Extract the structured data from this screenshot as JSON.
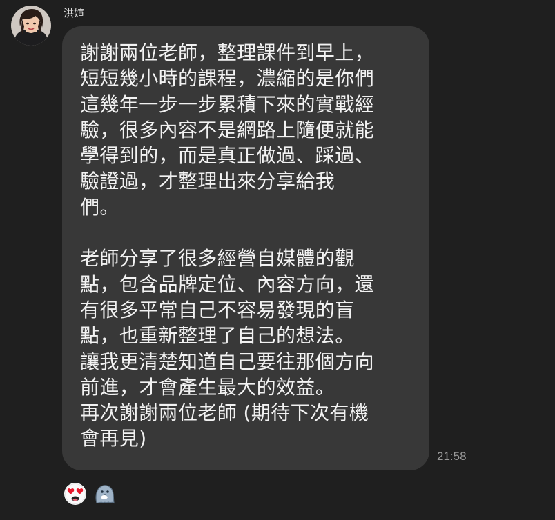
{
  "chat": {
    "sender_name": "洪媗",
    "message": {
      "paragraphs": [
        {
          "lines": [
            "謝謝兩位老師，整理課件到早上，",
            "短短幾小時的課程，濃縮的是你們",
            "這幾年一步一步累積下來的實戰經",
            "驗，很多內容不是網路上隨便就能",
            "學得到的，而是真正做過、踩過、",
            "驗證過，才整理出來分享給我",
            "們。"
          ]
        },
        {
          "lines": [
            "老師分享了很多經營自媒體的觀",
            "點，包含品牌定位、內容方向，還",
            "有很多平常自己不容易發現的盲",
            "點，也重新整理了自己的想法。",
            "讓我更清楚知道自己要往那個方向",
            "前進，才會產生最大的效益。",
            "再次謝謝兩位老師 (期待下次有機",
            "會再見)"
          ]
        }
      ],
      "time": "21:58"
    },
    "reactions": [
      {
        "icon": "heart-eyes-emoji-icon"
      },
      {
        "icon": "ghost-sticker-icon"
      }
    ]
  },
  "colors": {
    "background": "#1f1f1f",
    "bubble": "#383838",
    "text": "#f2f2f2",
    "name": "#d7d7d7",
    "time": "#9a9a9a"
  }
}
